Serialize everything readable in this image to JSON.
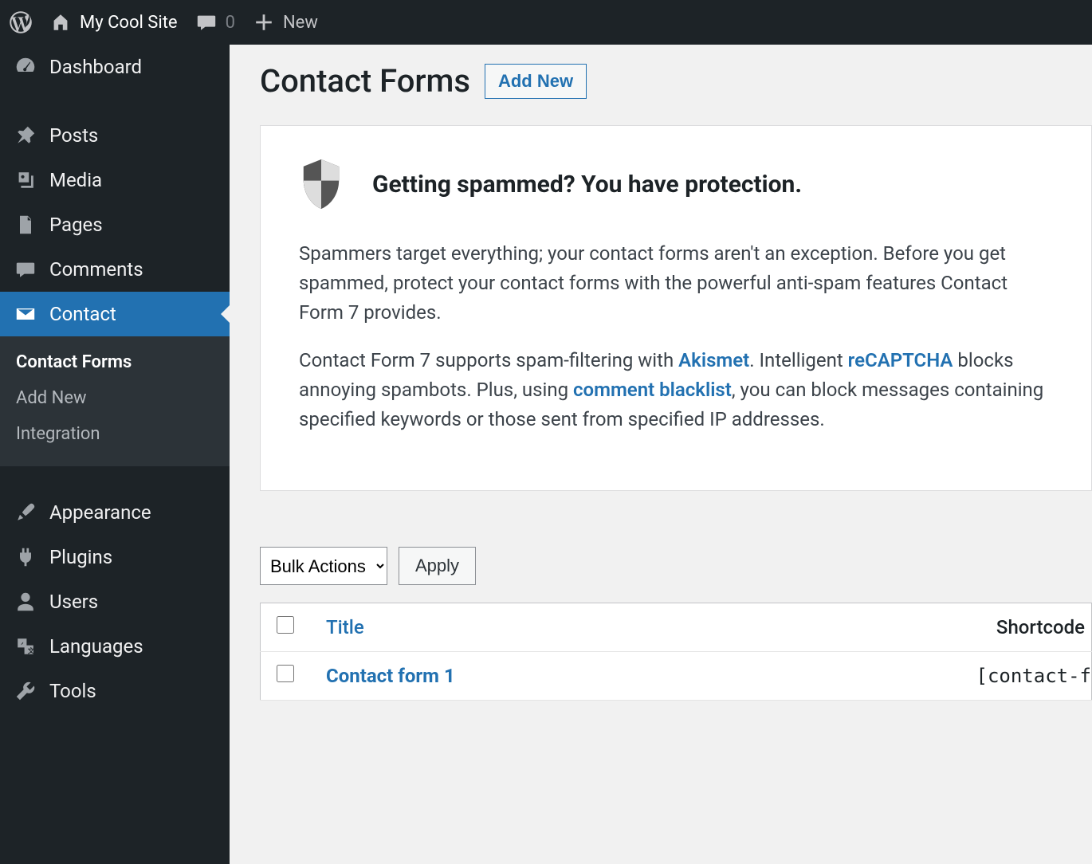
{
  "adminbar": {
    "site_name": "My Cool Site",
    "comments_count": "0",
    "new_label": "New"
  },
  "sidebar": {
    "items": [
      {
        "id": "dashboard",
        "label": "Dashboard",
        "icon": "gauge"
      },
      {
        "id": "posts",
        "label": "Posts",
        "icon": "pin"
      },
      {
        "id": "media",
        "label": "Media",
        "icon": "media"
      },
      {
        "id": "pages",
        "label": "Pages",
        "icon": "pages"
      },
      {
        "id": "comments",
        "label": "Comments",
        "icon": "comment"
      },
      {
        "id": "contact",
        "label": "Contact",
        "icon": "mail",
        "current": true
      },
      {
        "id": "appearance",
        "label": "Appearance",
        "icon": "brush"
      },
      {
        "id": "plugins",
        "label": "Plugins",
        "icon": "plug"
      },
      {
        "id": "users",
        "label": "Users",
        "icon": "user"
      },
      {
        "id": "languages",
        "label": "Languages",
        "icon": "translate"
      },
      {
        "id": "tools",
        "label": "Tools",
        "icon": "wrench"
      }
    ],
    "submenu": [
      {
        "label": "Contact Forms",
        "current": true
      },
      {
        "label": "Add New"
      },
      {
        "label": "Integration"
      }
    ]
  },
  "page": {
    "title": "Contact Forms",
    "add_new_label": "Add New"
  },
  "panel": {
    "heading": "Getting spammed? You have protection.",
    "p1": "Spammers target everything; your contact forms aren't an exception. Before you get spammed, protect your contact forms with the powerful anti-spam features Contact Form 7 provides.",
    "p2a": "Contact Form 7 supports spam-filtering with ",
    "link_akismet": "Akismet",
    "p2b": ". Intelligent ",
    "link_recaptcha": "reCAPTCHA",
    "p2c": " blocks annoying spambots. Plus, using ",
    "link_blacklist": "comment blacklist",
    "p2d": ", you can block messages containing specified keywords or those sent from specified IP addresses."
  },
  "bulk": {
    "select_label": "Bulk Actions",
    "apply_label": "Apply"
  },
  "table": {
    "col_title": "Title",
    "col_shortcode": "Shortcode",
    "rows": [
      {
        "title": "Contact form 1",
        "shortcode": "[contact-f"
      }
    ]
  }
}
